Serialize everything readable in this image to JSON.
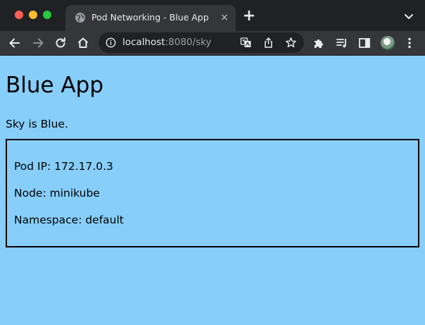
{
  "browser": {
    "tab": {
      "title": "Pod Networking - Blue App",
      "close_glyph": "×",
      "icon": "globe-icon"
    },
    "new_tab_glyph": "+",
    "url": {
      "host": "localhost",
      "rest": ":8080/sky"
    },
    "toolbar_icons": [
      "back-icon",
      "forward-icon",
      "reload-icon",
      "home-icon",
      "info-icon",
      "translate-icon",
      "share-icon",
      "star-icon",
      "extensions-icon",
      "reading-list-icon",
      "side-panel-icon",
      "avatar",
      "more-icon"
    ]
  },
  "page": {
    "heading": "Blue App",
    "subtitle": "Sky is Blue.",
    "info": {
      "pod_ip": "Pod IP: 172.17.0.3",
      "node": "Node: minikube",
      "namespace": "Namespace: default"
    },
    "background_color": "#87cefa"
  }
}
